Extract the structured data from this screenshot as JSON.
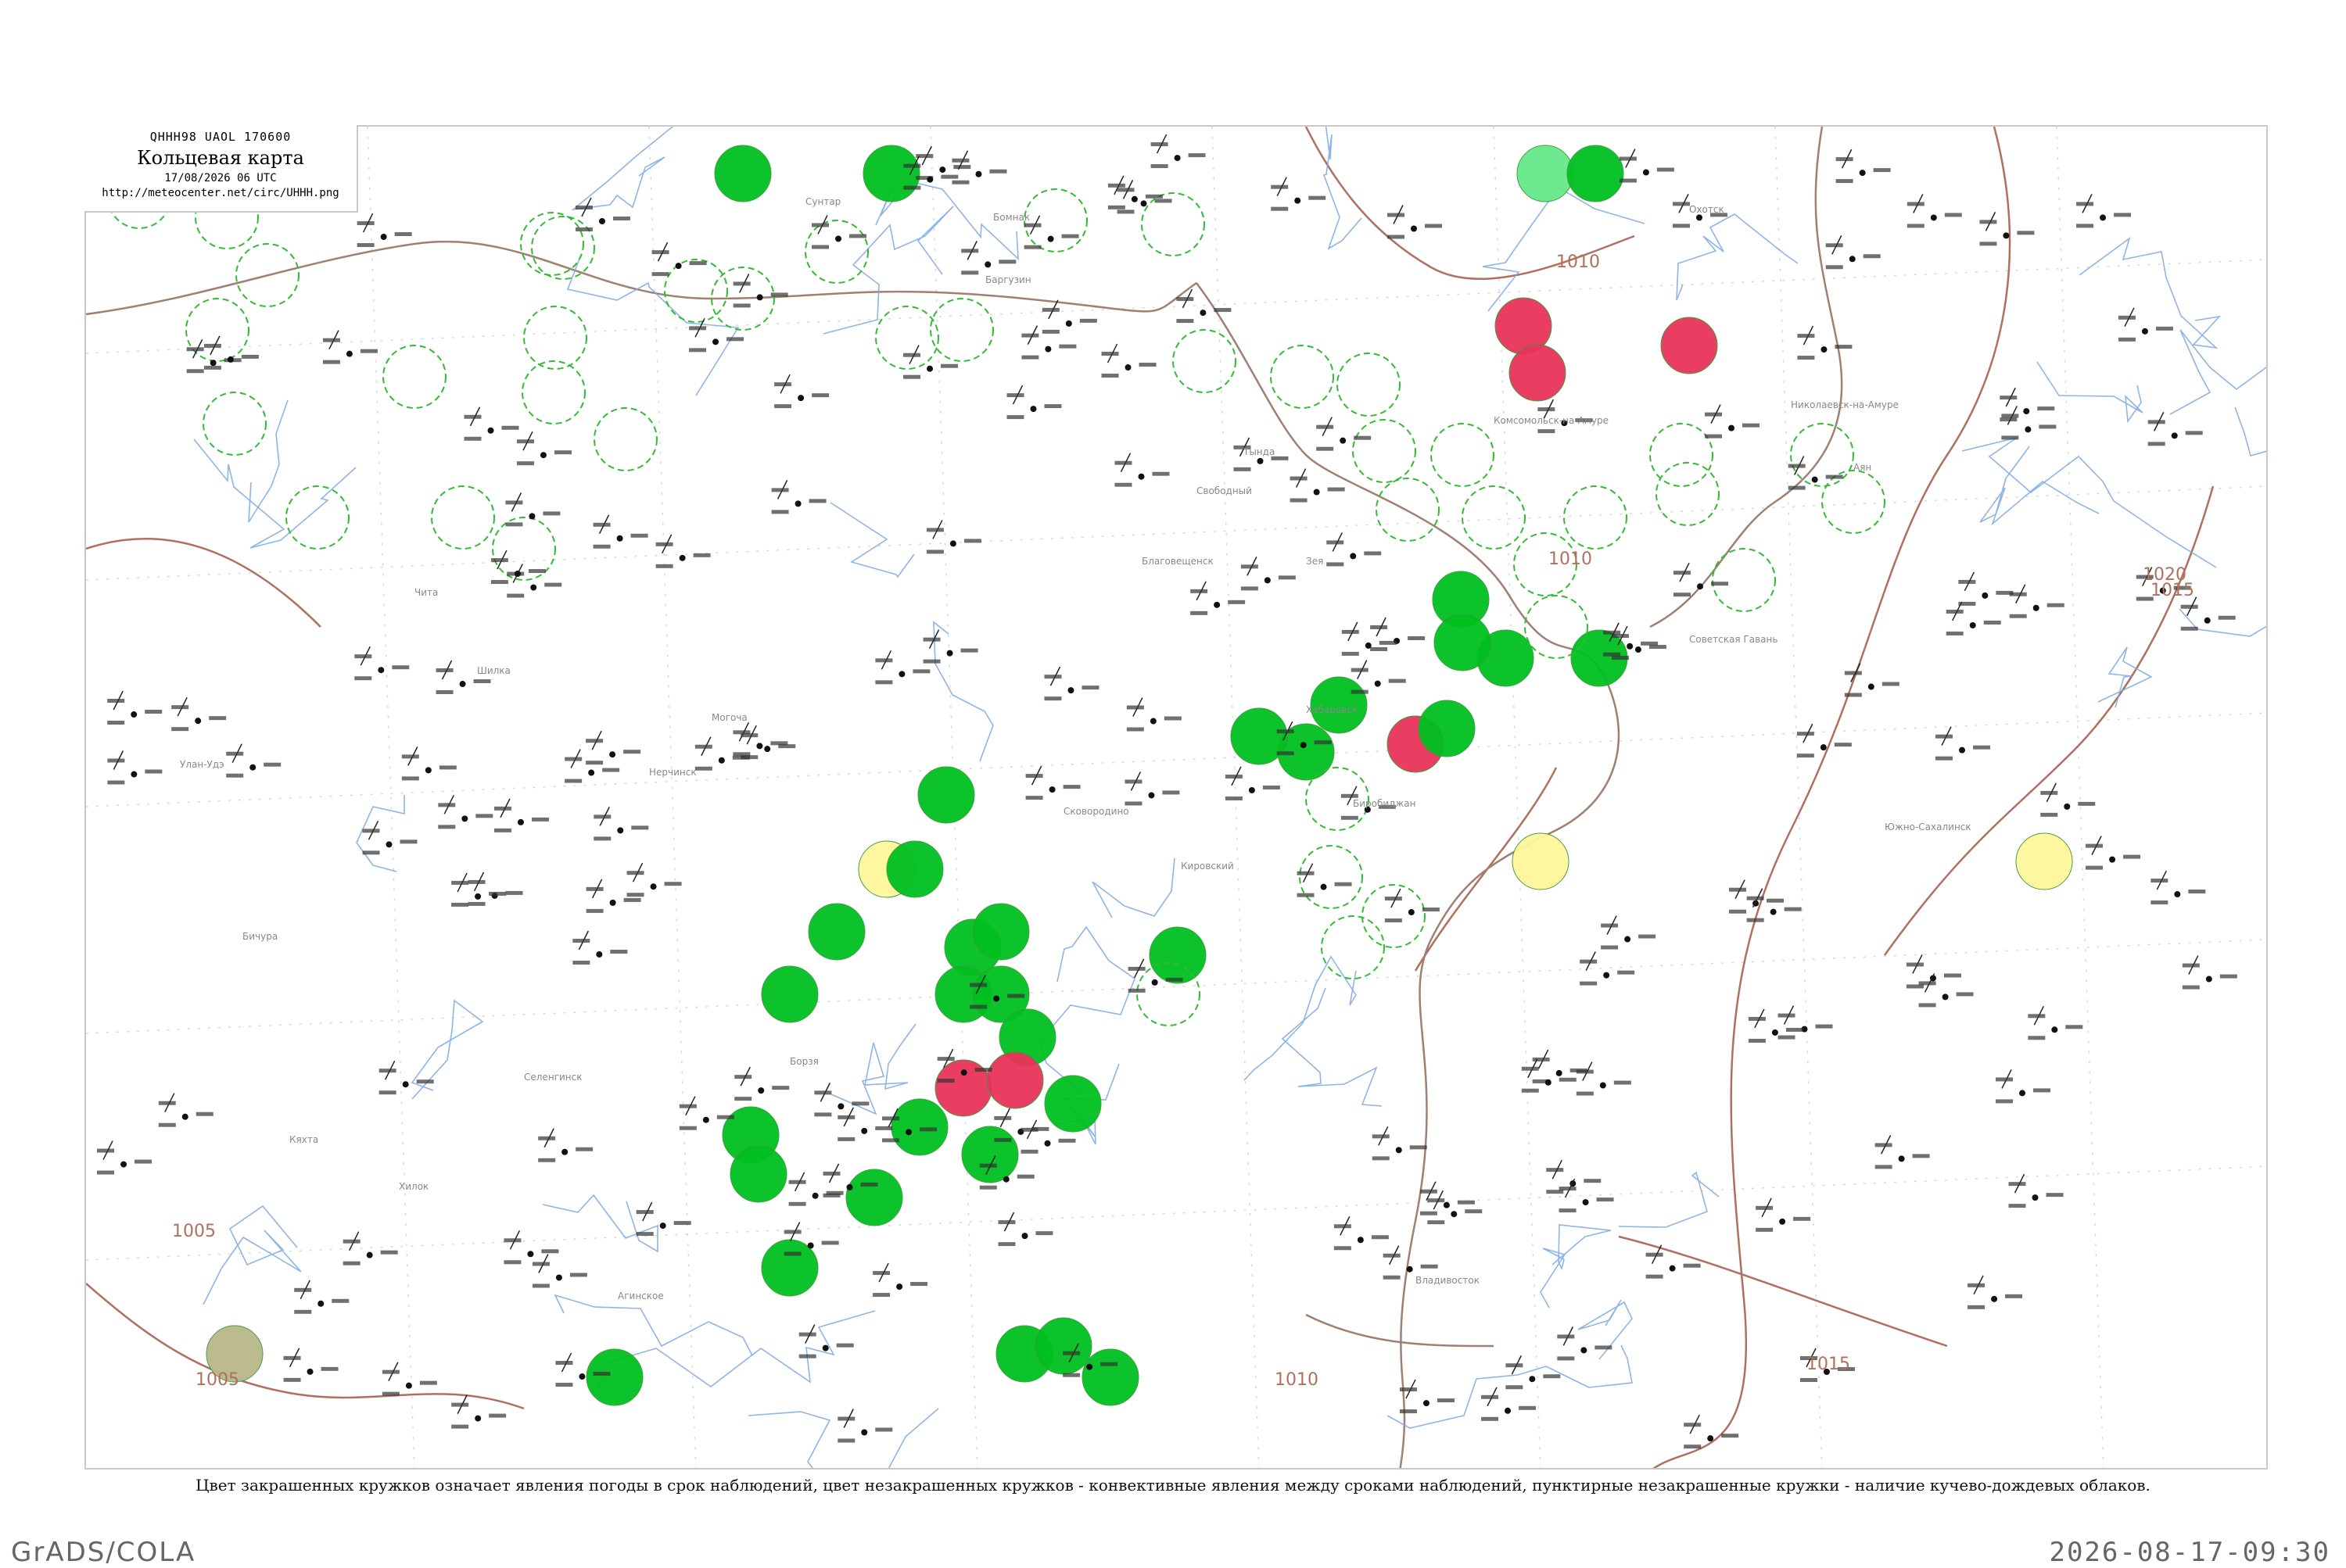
{
  "header": {
    "code": "QHHH98  UAOL  170600",
    "title": "Кольцевая карта",
    "valid_time": "17/08/2026 06 UTC",
    "url": "http://meteocenter.net/circ/UHHH.png"
  },
  "caption": "Цвет закрашенных кружков означает явления погоды в срок наблюдений, цвет незакрашенных кружков - конвективные явления между сроками наблюдений, пунктирные незакрашенные кружки - наличие кучево-дождевых облаков.",
  "footer": {
    "left": "GrADS/COLA",
    "right": "2026-08-17-09:30"
  },
  "isobar_labels": [
    "1010",
    "1010",
    "1015",
    "1020",
    "1005",
    "1005",
    "1015",
    "1010"
  ],
  "colors": {
    "precip_green": "#00c020",
    "thunder_red": "#e8335a",
    "fog_yellow": "#fff79a",
    "haze_olive": "#b8b88a",
    "light_green": "#66e88a",
    "cb_dashed": "#33bb33",
    "river": "#7aa8e0",
    "isobar": "#b07060",
    "border": "#a08070"
  },
  "station_labels": [
    "Хабаровск",
    "Комсомольск-на-Амуре",
    "Николаевск-на-Амуре",
    "Благовещенск",
    "Чита",
    "Улан-Удэ",
    "Нерчинск",
    "Сковородино",
    "Тында",
    "Зея",
    "Свободный",
    "Биробиджан",
    "Владивосток",
    "Охотск",
    "Аян",
    "Сунтар",
    "Бомнак",
    "Шилка",
    "Могоча",
    "Борзя",
    "Советская Гавань",
    "Южно-Сахалинск",
    "Кировский",
    "Бичура",
    "Кяхта",
    "Хилок",
    "Селенгинск",
    "Баргузин",
    "Агинское"
  ]
}
